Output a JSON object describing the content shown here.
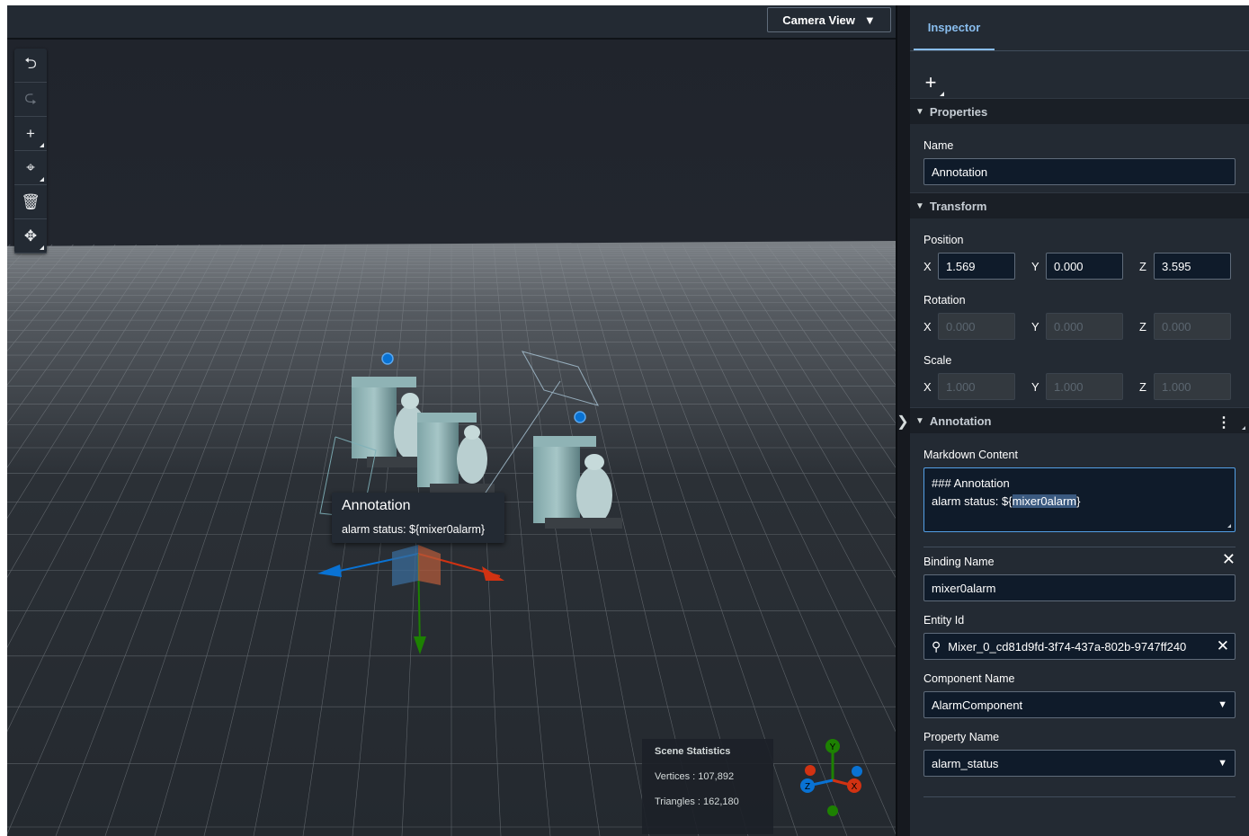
{
  "viewport": {
    "camera_view_label": "Camera View",
    "toolbar": [
      {
        "name": "undo-icon",
        "glyph": "⮌",
        "enabled": true
      },
      {
        "name": "redo-icon",
        "glyph": "⮎",
        "enabled": false
      },
      {
        "name": "add-object-icon",
        "glyph": "+",
        "enabled": true
      },
      {
        "name": "orbit-icon",
        "glyph": "⌖",
        "enabled": true
      },
      {
        "name": "delete-icon",
        "glyph": "🗑",
        "enabled": true
      },
      {
        "name": "move-icon",
        "glyph": "✥",
        "enabled": true
      }
    ],
    "tooltip": {
      "title": "Annotation",
      "body": "alarm status: ${mixer0alarm}"
    },
    "stats": {
      "heading": "Scene Statistics",
      "vertices": "Vertices : 107,892",
      "triangles": "Triangles : 162,180"
    },
    "gizmo_axes": {
      "y": "Y",
      "x": "X",
      "z": "Z"
    }
  },
  "inspector": {
    "tab_label": "Inspector",
    "properties": {
      "section": "Properties",
      "name_label": "Name",
      "name_value": "Annotation"
    },
    "transform": {
      "section": "Transform",
      "position_label": "Position",
      "position": {
        "x": "1.569",
        "y": "0.000",
        "z": "3.595"
      },
      "rotation_label": "Rotation",
      "rotation": {
        "x": "0.000",
        "y": "0.000",
        "z": "0.000"
      },
      "scale_label": "Scale",
      "scale": {
        "x": "1.000",
        "y": "1.000",
        "z": "1.000"
      },
      "axis_x": "X",
      "axis_y": "Y",
      "axis_z": "Z"
    },
    "annotation": {
      "section": "Annotation",
      "markdown_label": "Markdown Content",
      "markdown_line1": "### Annotation",
      "markdown_line2_prefix": "alarm status: ${",
      "markdown_line2_selected": "mixer0alarm",
      "markdown_line2_suffix": "}",
      "binding_label": "Binding Name",
      "binding_value": "mixer0alarm",
      "entity_label": "Entity Id",
      "entity_value": "Mixer_0_cd81d9fd-3f74-437a-802b-9747ff240",
      "component_label": "Component Name",
      "component_value": "AlarmComponent",
      "property_label": "Property Name",
      "property_value": "alarm_status"
    }
  },
  "colors": {
    "accent": "#89bdee",
    "axis_x": "#d13212",
    "axis_y": "#1d8102",
    "axis_z": "#0972d3"
  }
}
